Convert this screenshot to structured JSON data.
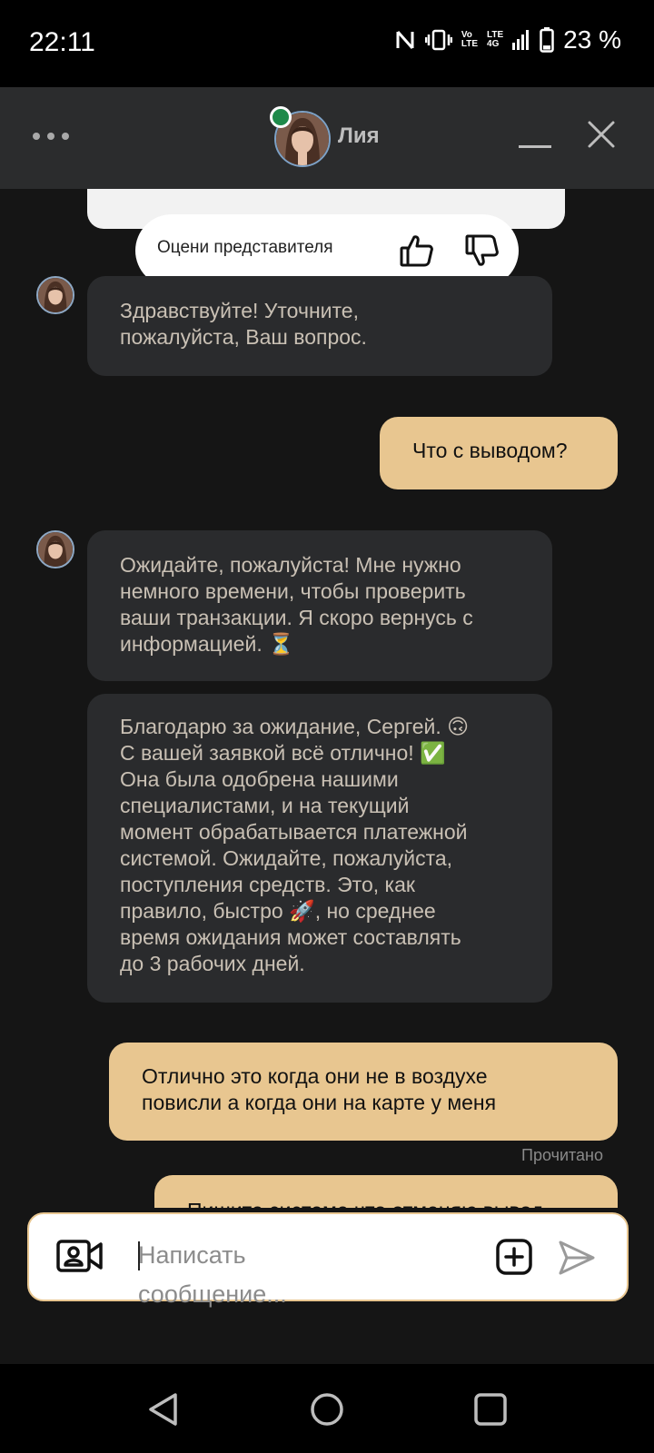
{
  "status_bar": {
    "time": "22:11",
    "network_top": "Vo",
    "network_bottom": "LTE",
    "lte_top": "LTE",
    "lte_bottom": "4G",
    "battery_percent": "23 %",
    "battery_level": 0.23,
    "icons": [
      "nfc-icon",
      "vibrate-icon",
      "volte-icon",
      "signal-icon",
      "battery-icon"
    ]
  },
  "header": {
    "agent_name": "Лия",
    "online": true,
    "status_color": "#1e8a4a",
    "icons": [
      "more-icon",
      "minimize-icon",
      "close-icon"
    ]
  },
  "rating": {
    "prompt": "Оцени представителя",
    "icons": [
      "thumbs-up-icon",
      "thumbs-down-icon"
    ]
  },
  "messages": [
    {
      "from": "agent",
      "text": "Здравствуйте! Уточните,\nпожалуйста, Ваш вопрос."
    },
    {
      "from": "user",
      "text": "Что с выводом?"
    },
    {
      "from": "agent",
      "text": "Ожидайте, пожалуйста! Мне нужно\nнемного времени, чтобы проверить\nваши транзакции. Я скоро вернусь с\nинформацией. ⏳"
    },
    {
      "from": "agent",
      "text": "Благодарю за ожидание, Сергей. 🙃\nС вашей заявкой всё отлично! ✅\nОна была одобрена нашими\nспециалистами, и на текущий\nмомент обрабатывается платежной\nсистемой. Ожидайте, пожалуйста,\nпоступления средств. Это, как\nправило, быстро 🚀, но среднее\nвремя ожидания может составлять\nдо 3 рабочих дней."
    },
    {
      "from": "user",
      "text": "Отлично это когда они не в воздухе\nповисли а когда они на карте у меня"
    },
    {
      "from": "user",
      "text": "Пишите системе что отменяю вывод"
    }
  ],
  "read_status": "Прочитано",
  "composer": {
    "placeholder": "Написать\nсообщение...",
    "icons": [
      "video-call-icon",
      "attach-icon",
      "send-icon"
    ]
  },
  "nav_bar": {
    "icons": [
      "back-icon",
      "home-icon",
      "recents-icon"
    ]
  },
  "colors": {
    "accent": "#e8c690",
    "agent_bubble": "#2a2b2d",
    "agent_text": "#c9c0b4",
    "background": "#151515",
    "header": "#2b2c2d"
  }
}
